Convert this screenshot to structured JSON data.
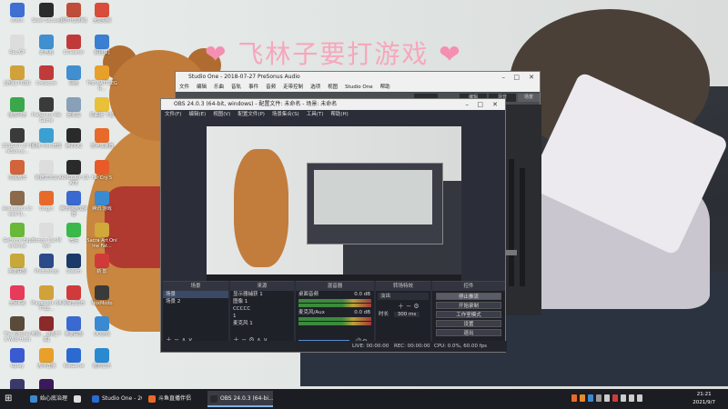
{
  "banner": {
    "text": "飞林子要打游戏",
    "heart": "❤"
  },
  "desktop_icons": [
    {
      "label": "kiWin",
      "color": "#3f6fd1"
    },
    {
      "label": "Steel Secuse",
      "color": "#2b2b2b"
    },
    {
      "label": "超时代[录制]",
      "color": "#c04c3a"
    },
    {
      "label": "全能视频",
      "color": "#d94c3a"
    },
    {
      "label": "Rec/GF",
      "color": "#ddd"
    },
    {
      "label": "此电脑",
      "color": "#3f8fd1"
    },
    {
      "label": "CCleaner",
      "color": "#c03a3a"
    },
    {
      "label": "超越[1]",
      "color": "#3a7fd1"
    },
    {
      "label": "[游侠] PUBG",
      "color": "#d1a23a"
    },
    {
      "label": "CreScore",
      "color": "#c03a3a"
    },
    {
      "label": "网络",
      "color": "#3f8fd1"
    },
    {
      "label": "THE BATTLEGR...",
      "color": "#e8a02a"
    },
    {
      "label": "播放列表",
      "color": "#3aa84a"
    },
    {
      "label": "PreSonus WeGame",
      "color": "#3a3a3a"
    },
    {
      "label": "回收站",
      "color": "#88a0b8"
    },
    {
      "label": "原曲版 下载",
      "color": "#e8c03a"
    },
    {
      "label": "2018-07-27 PreSonus...",
      "color": "#3a3a3a"
    },
    {
      "label": "超级 MoC管理",
      "color": "#3aa0d1"
    },
    {
      "label": "腾讯QQ",
      "color": "#2a2a2a"
    },
    {
      "label": "雷神加速器",
      "color": "#e86a2a"
    },
    {
      "label": "浓缩精华",
      "color": "#d1643a"
    },
    {
      "label": "新建文本文",
      "color": "#ddd"
    },
    {
      "label": "ARMOURY CRATE",
      "color": "#2a2a2a"
    },
    {
      "label": "Far Cry 5",
      "color": "#e85a2a"
    },
    {
      "label": "Assassin's Creed O...",
      "color": "#8a6a4a"
    },
    {
      "label": "Origin",
      "color": "#e86a2a"
    },
    {
      "label": "腾讯网游加速器",
      "color": "#3a6ad1"
    },
    {
      "label": "腾讯 游戏",
      "color": "#3a8ad1"
    },
    {
      "label": "GeForce Experience",
      "color": "#6ab83a"
    },
    {
      "label": "Bongo Cat Mver",
      "color": "#ddd"
    },
    {
      "label": "微信",
      "color": "#3ab84a"
    },
    {
      "label": "Sacra Art Online Fat...",
      "color": "#d1a83a"
    },
    {
      "label": "英雄联盟",
      "color": "#c8a83a"
    },
    {
      "label": "Photoshop",
      "color": "#2a4a8a"
    },
    {
      "label": "Steam",
      "color": "#1a3a6a"
    },
    {
      "label": "新 影",
      "color": "#d13a3a"
    },
    {
      "label": "全民K歌",
      "color": "#e83a5a"
    },
    {
      "label": "PlayerUnk BATTLE...",
      "color": "#d1a23a"
    },
    {
      "label": "网易云音乐",
      "color": "#d13a3a"
    },
    {
      "label": "NoxModo",
      "color": "#3a3a3a"
    },
    {
      "label": "The Witcher 3 Wild Hunt",
      "color": "#5a4a3a"
    },
    {
      "label": "地铁... 游戏[下载]",
      "color": "#8a2a2a"
    },
    {
      "label": "英雄联盟",
      "color": "#3a6ad1"
    },
    {
      "label": "QQ游戏",
      "color": "#3a8ad1"
    },
    {
      "label": "Uplay",
      "color": "#3a5ad1"
    },
    {
      "label": "虎牙直播",
      "color": "#e8a02a"
    },
    {
      "label": "WeGame",
      "color": "#2a6ad1"
    },
    {
      "label": "酷狗音乐",
      "color": "#2a8ad1"
    },
    {
      "label": "掌握大楼",
      "color": "#3a3a6a"
    },
    {
      "label": "Adobe Premiere...",
      "color": "#3a1a5a"
    }
  ],
  "studio": {
    "title": "Studio One - 2018-07-27 PreSonus Audio",
    "menu": [
      "文件",
      "编辑",
      "乐曲",
      "音轨",
      "事件",
      "音频",
      "走带控制",
      "选项",
      "视图",
      "Studio One",
      "帮助"
    ],
    "toolbar": {
      "btn1": "编辑",
      "btn2": "混音",
      "btn3": "浏览",
      "btn4": "场景"
    }
  },
  "obs": {
    "title": "OBS 24.0.3 (64-bit, windows) - 配置文件: 未命名 - 场景: 未命名",
    "menu": [
      "文件(F)",
      "编辑(E)",
      "视图(V)",
      "配置文件(P)",
      "场景集合(S)",
      "工具(T)",
      "帮助(H)"
    ],
    "docks": {
      "scenes": {
        "header": "场景",
        "items": [
          "场景",
          "场景 2"
        ]
      },
      "sources": {
        "header": "来源",
        "items": [
          "显示器捕获 1",
          "图像 1",
          "CCCCC",
          "1",
          "麦克风 1"
        ]
      },
      "mixer": {
        "header": "混音器",
        "items": [
          {
            "name": "桌面音频",
            "db": "0.0 dB"
          },
          {
            "name": "麦克风/Aux",
            "db": "0.0 dB"
          }
        ]
      },
      "transitions": {
        "header": "转场特效",
        "type": "淡出",
        "duration_label": "时长",
        "duration_value": "300 ms"
      },
      "controls": {
        "header": "控件",
        "buttons": [
          "停止推流",
          "开始录制",
          "工作室模式",
          "设置",
          "退出"
        ]
      }
    },
    "status": {
      "live": "LIVE: 00:00:00",
      "rec": "REC: 00:00:00",
      "cpu": "CPU: 0.0%, 60.00 fps"
    }
  },
  "taskbar": {
    "items": [
      {
        "label": "始心底治理理_效视...",
        "active": false,
        "color": "#3a8ad1"
      },
      {
        "label": "",
        "active": false,
        "color": "#ddd"
      },
      {
        "label": "Studio One - 201...",
        "active": false,
        "color": "#2a6ad1"
      },
      {
        "label": "斗鱼直播伴侣",
        "active": false,
        "color": "#e86a2a"
      },
      {
        "label": "OBS 24.0.3 (64-bi...",
        "active": true,
        "color": "#2a2a2a"
      }
    ],
    "time": "21:21",
    "date": "2021/9/7"
  }
}
